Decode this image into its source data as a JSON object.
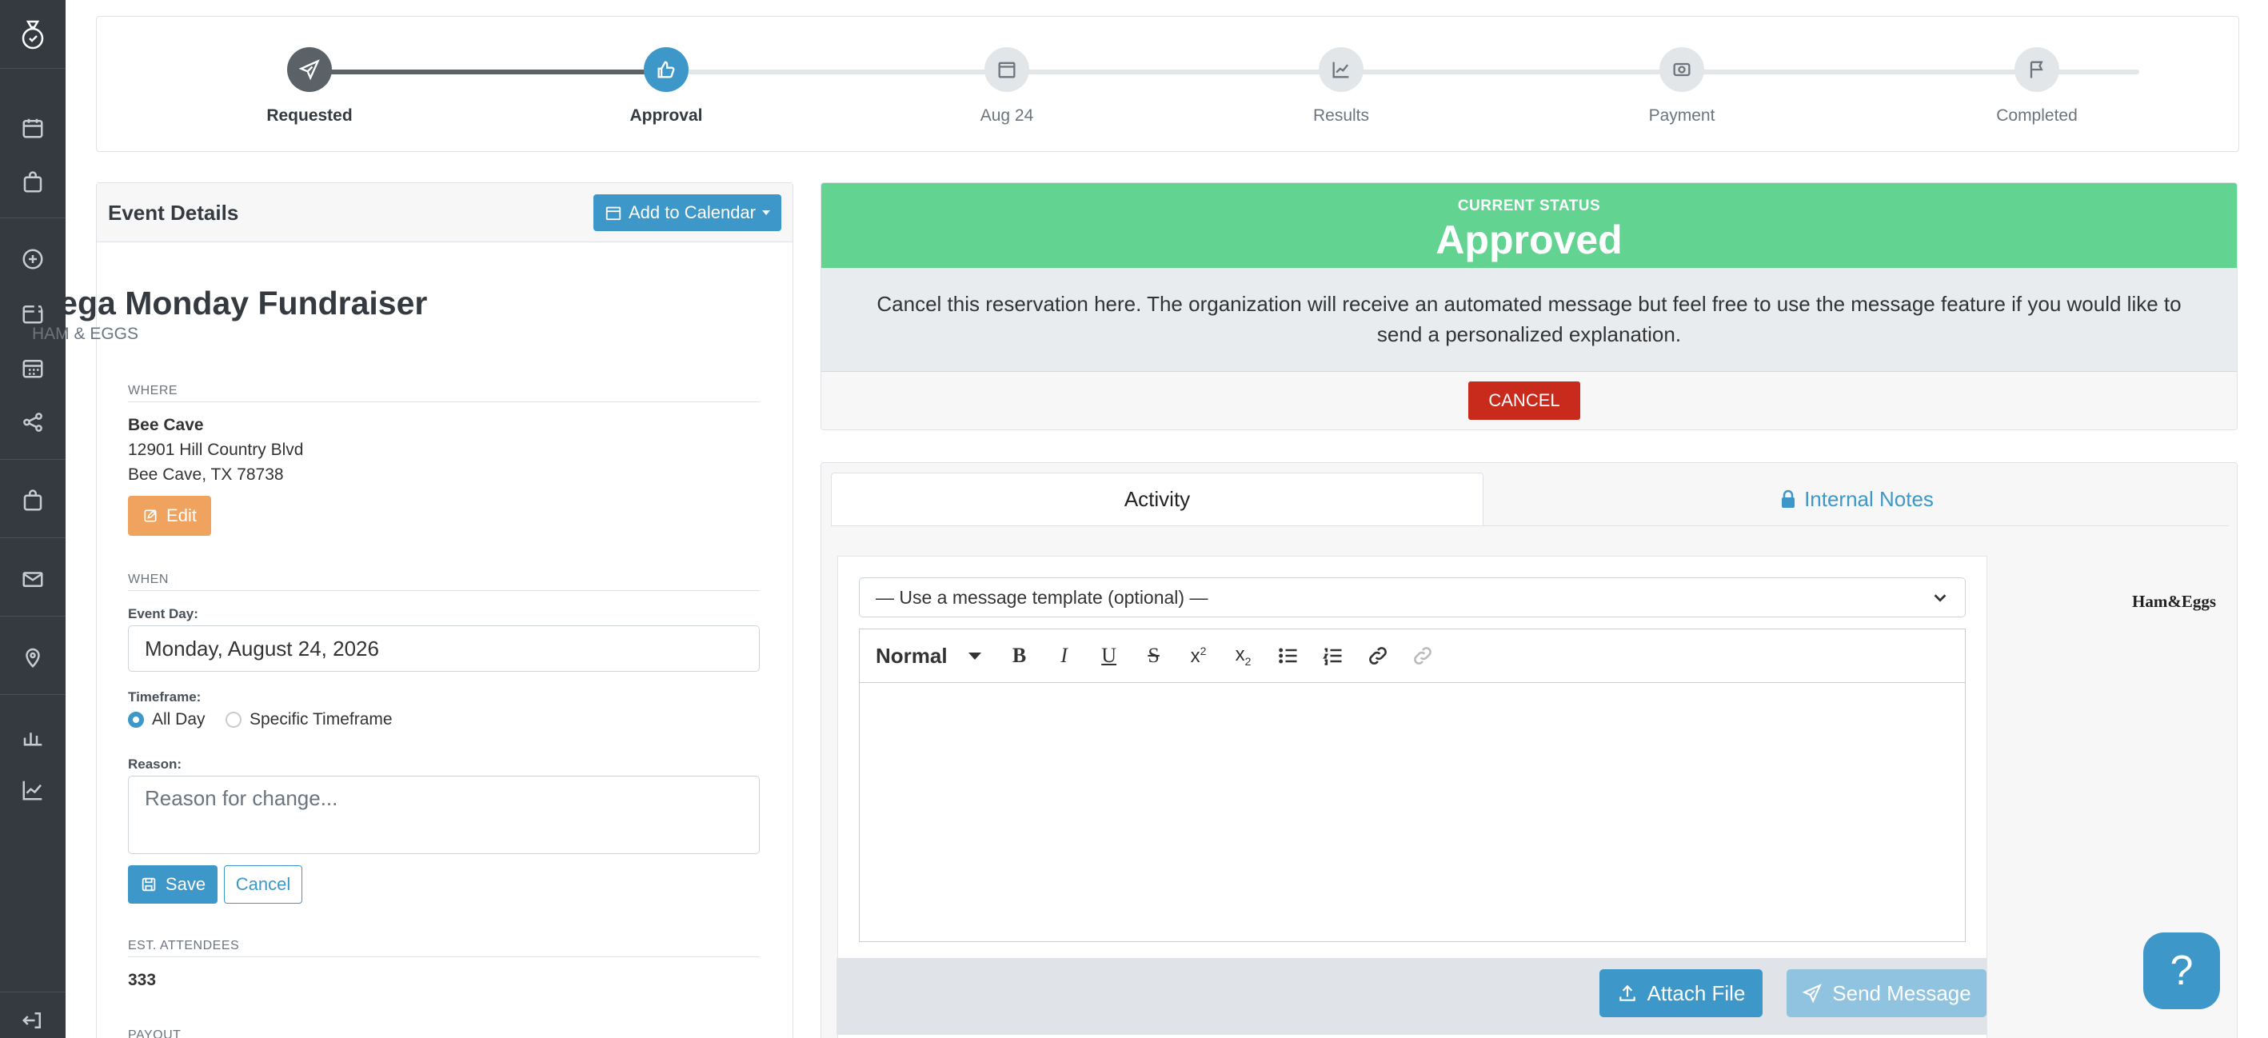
{
  "stepper": {
    "steps": [
      {
        "label": "Requested",
        "icon": "paper-plane-icon",
        "state": "done"
      },
      {
        "label": "Approval",
        "icon": "thumbs-up-icon",
        "state": "current"
      },
      {
        "label": "Aug 24",
        "icon": "calendar-icon",
        "state": "pending"
      },
      {
        "label": "Results",
        "icon": "chart-line-icon",
        "state": "pending"
      },
      {
        "label": "Payment",
        "icon": "money-icon",
        "state": "pending"
      },
      {
        "label": "Completed",
        "icon": "flag-icon",
        "state": "pending"
      }
    ]
  },
  "details": {
    "header": "Event Details",
    "calendar_button": "Add to Calendar",
    "event_name": "Mega Monday Fundraiser",
    "organization": "HAM & EGGS",
    "where_label": "WHERE",
    "venue": "Bee Cave",
    "address1": "12901 Hill Country Blvd",
    "address2": "Bee Cave, TX 78738",
    "edit_button": "Edit",
    "when_label": "WHEN",
    "event_day_label": "Event Day:",
    "event_day_value": "Monday, August 24, 2026",
    "timeframe_label": "Timeframe:",
    "timeframe_options": [
      "All Day",
      "Specific Timeframe"
    ],
    "timeframe_selected": "All Day",
    "reason_label": "Reason:",
    "reason_placeholder": "Reason for change...",
    "save_button": "Save",
    "cancel_button": "Cancel",
    "attendees_label": "EST. ATTENDEES",
    "attendees_value": "333",
    "payout_label": "PAYOUT"
  },
  "status": {
    "eyebrow": "CURRENT STATUS",
    "title": "Approved",
    "message": "Cancel this reservation here. The organization will receive an automated message but feel free to use the message feature if you would like to send a personalized explanation.",
    "cancel_button": "CANCEL",
    "color": "#62d391"
  },
  "messaging": {
    "tabs": [
      "Activity",
      "Internal Notes"
    ],
    "active_tab": "Activity",
    "template_select": "— Use a message template (optional) —",
    "format_select": "Normal",
    "attach_button": "Attach File",
    "send_button": "Send Message",
    "brand_text": "Ham&Eggs"
  },
  "help_button": "?",
  "colors": {
    "accent": "#3d97c9",
    "success": "#62d391",
    "danger": "#c82a1c",
    "sidebar": "#343a40"
  }
}
